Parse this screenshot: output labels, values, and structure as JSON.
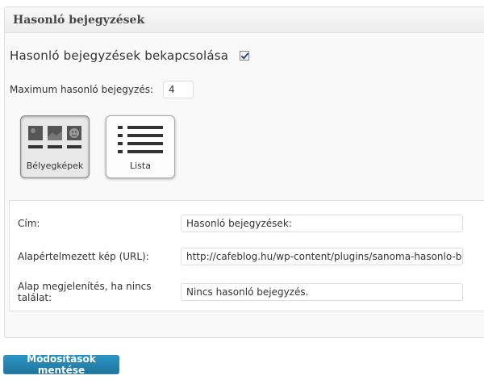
{
  "panel": {
    "title": "Hasonló bejegyzések"
  },
  "enable": {
    "label": "Hasonló bejegyzések bekapcsolása",
    "checked": true
  },
  "max_posts": {
    "label": "Maximum hasonló bejegyzés:",
    "value": "4"
  },
  "display_styles": [
    {
      "label": "Bélyegképek",
      "icon": "thumbnails-icon",
      "selected": true
    },
    {
      "label": "Lista",
      "icon": "list-icon",
      "selected": false
    }
  ],
  "fields": [
    {
      "label": "Cím:",
      "value": "Hasonló bejegyzések:"
    },
    {
      "label": "Alapértelmezett kép (URL):",
      "value": "http://cafeblog.hu/wp-content/plugins/sanoma-hasonlo-bejegyz"
    },
    {
      "label": "Alap megjelenítés, ha nincs találat:",
      "value": "Nincs hasonló bejegyzés."
    }
  ],
  "save_label": "Módosítások mentése",
  "colors": {
    "primary_button": "#21759b",
    "checkmark": "#2a4a8a"
  }
}
